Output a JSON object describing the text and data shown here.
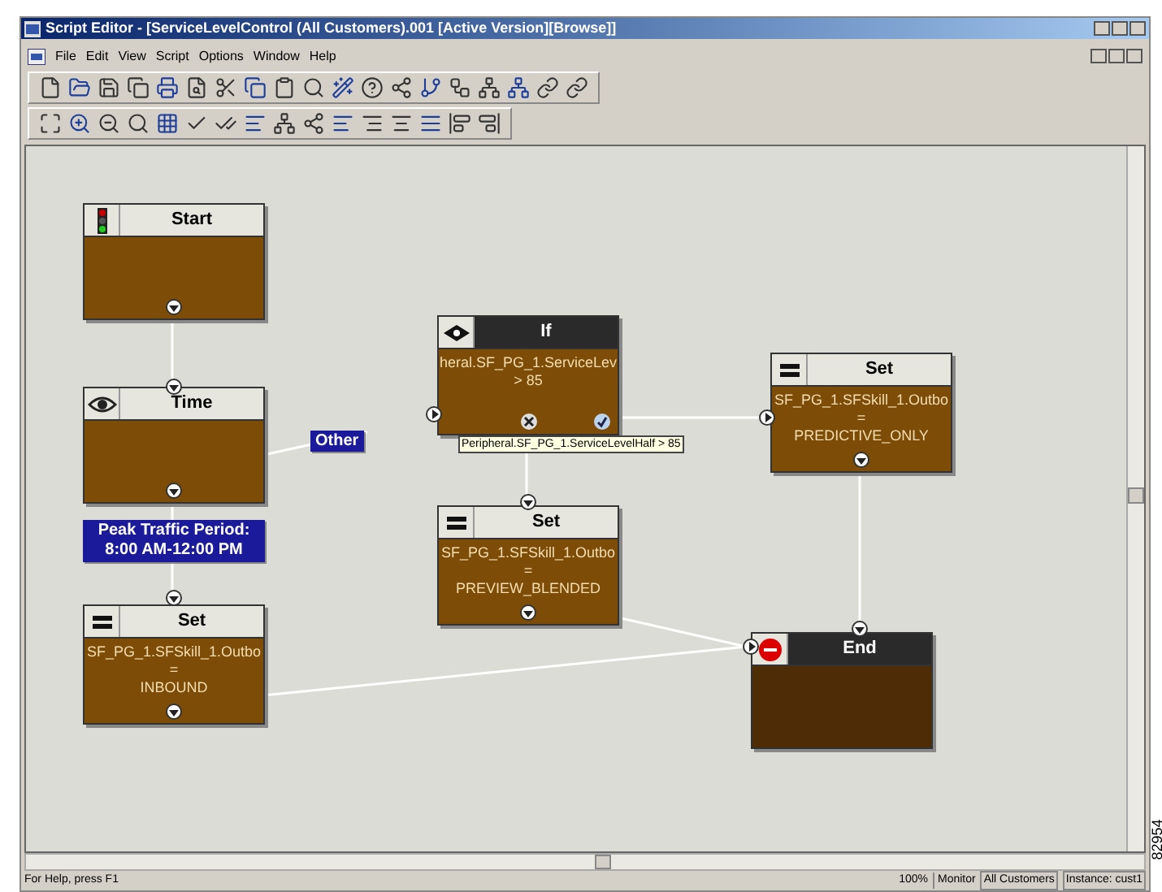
{
  "window": {
    "title": "Script Editor - [ServiceLevelControl (All Customers).001 [Active Version][Browse]]"
  },
  "menu": [
    "File",
    "Edit",
    "View",
    "Script",
    "Options",
    "Window",
    "Help"
  ],
  "nodes": [
    {
      "kind": "start",
      "title": "Start"
    },
    {
      "kind": "time",
      "title": "Time"
    },
    {
      "kind": "if",
      "title": "If",
      "lines": [
        "heral.SF_PG_1.ServiceLev",
        "> 85"
      ]
    },
    {
      "kind": "set",
      "title": "Set",
      "lines": [
        "SF_PG_1.SFSkill_1.Outbo",
        "=",
        "PREDICTIVE_ONLY"
      ]
    },
    {
      "kind": "set",
      "title": "Set",
      "lines": [
        "SF_PG_1.SFSkill_1.Outbo",
        "=",
        "PREVIEW_BLENDED"
      ]
    },
    {
      "kind": "set",
      "title": "Set",
      "lines": [
        "SF_PG_1.SFSkill_1.Outbo",
        "=",
        "INBOUND"
      ]
    },
    {
      "kind": "end",
      "title": "End"
    }
  ],
  "labels": [
    {
      "text": "Other"
    },
    {
      "text": "Peak Traffic Period:\n8:00 AM-12:00 PM"
    }
  ],
  "tooltip": "Peripheral.SF_PG_1.ServiceLevelHalf > 85",
  "status_bar": {
    "help": "For Help, press F1",
    "zoom": "100%",
    "mode": "Monitor",
    "customer": "All Customers",
    "instance": "Instance: cust1"
  },
  "figure_id": "82954"
}
